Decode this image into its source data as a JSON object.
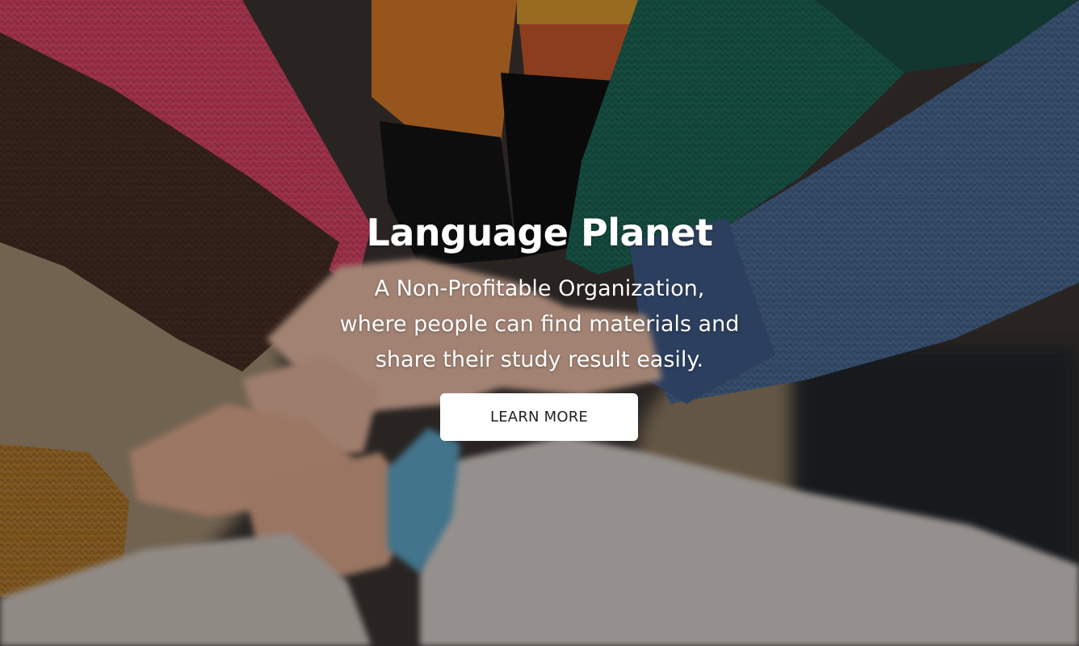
{
  "hero": {
    "title": "Language Planet",
    "subtitle": "A Non-Profitable Organization, where people can find materials and share their study result easily.",
    "cta_label": "LEARN MORE"
  },
  "colors": {
    "text": "#ffffff",
    "button_bg": "#ffffff",
    "button_text": "#222222"
  }
}
